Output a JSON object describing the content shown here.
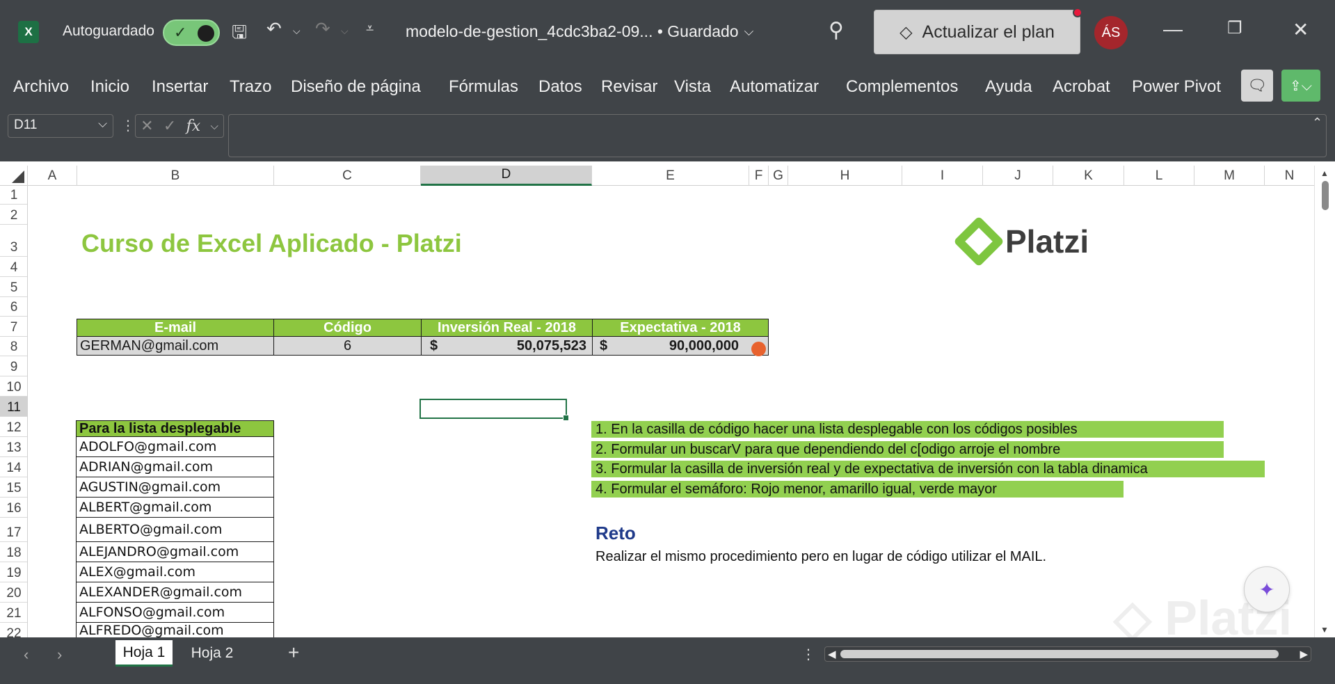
{
  "titlebar": {
    "app_icon": "excel-icon",
    "autosave_label": "Autoguardado",
    "filename": "modelo-de-gestion_4cdc3ba2-09... • Guardado",
    "upgrade_label": "Actualizar el plan",
    "avatar_initials": "ÁS",
    "accent_color": "#78c679"
  },
  "ribbon": {
    "tabs": [
      "Archivo",
      "Inicio",
      "Insertar",
      "Trazo",
      "Diseño de página",
      "Fórmulas",
      "Datos",
      "Revisar",
      "Vista",
      "Automatizar",
      "Complementos",
      "Ayuda",
      "Acrobat",
      "Power Pivot"
    ]
  },
  "formula_bar": {
    "name_box": "D11",
    "fx_label": "fx",
    "formula_value": ""
  },
  "grid": {
    "columns": [
      "A",
      "B",
      "C",
      "D",
      "E",
      "F",
      "G",
      "H",
      "I",
      "J",
      "K",
      "L",
      "M",
      "N"
    ],
    "selected_column": "D",
    "rows": [
      "1",
      "2",
      "3",
      "4",
      "5",
      "6",
      "7",
      "8",
      "9",
      "10",
      "11",
      "12",
      "13",
      "14",
      "15",
      "16",
      "17",
      "18",
      "19",
      "20",
      "21",
      "22"
    ]
  },
  "sheet": {
    "title": "Curso de Excel Aplicado - Platzi",
    "logo_text": "Platzi",
    "table": {
      "headers": [
        "E-mail",
        "Código",
        "Inversión Real - 2018",
        "Expectativa - 2018"
      ],
      "row": {
        "email": "GERMAN@gmail.com",
        "codigo": "6",
        "inversion_currency": "$",
        "inversion_value": "50,075,523",
        "expectativa_currency": "$",
        "expectativa_value": "90,000,000"
      },
      "traffic_light_color": "#e8622e"
    },
    "list": {
      "header": "Para la lista desplegable",
      "items": [
        "ADOLFO@gmail.com",
        "ADRIAN@gmail.com",
        "AGUSTIN@gmail.com",
        "ALBERT@gmail.com",
        "ALBERTO@gmail.com",
        "ALEJANDRO@gmail.com",
        "ALEX@gmail.com",
        "ALEXANDER@gmail.com",
        "ALFONSO@gmail.com",
        "ALFREDO@gmail.com"
      ]
    },
    "instructions": [
      "1. En la casilla de código hacer una lista desplegable con los códigos posibles",
      "2. Formular un buscarV para que dependiendo del c[odigo arroje el nombre",
      "3. Formular la casilla de inversión real y de expectativa de inversión con la tabla dinamica",
      "4. Formular el semáforo: Rojo menor, amarillo igual, verde mayor"
    ],
    "reto": {
      "title": "Reto",
      "text": "Realizar el mismo procedimiento pero en lugar de código utilizar el MAIL."
    },
    "brand_green": "#8dc63f"
  },
  "sheet_tabs": {
    "tabs": [
      "Hoja 1",
      "Hoja 2"
    ],
    "active": "Hoja 1"
  }
}
